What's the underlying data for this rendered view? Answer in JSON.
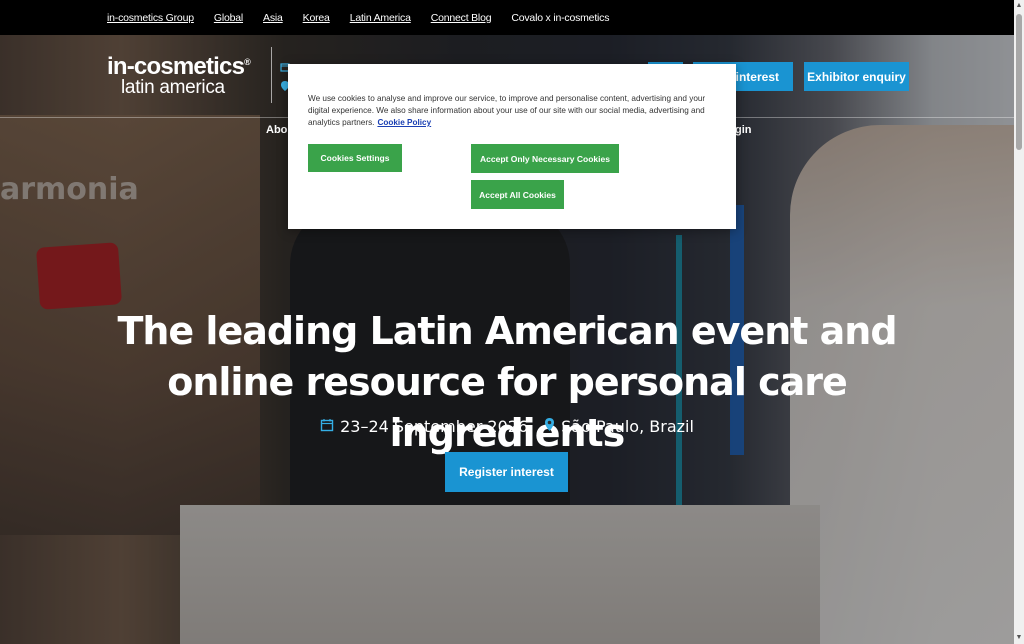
{
  "topbar": {
    "links": [
      {
        "label": "in-cosmetics Group"
      },
      {
        "label": "Global"
      },
      {
        "label": "Asia"
      },
      {
        "label": "Korea"
      },
      {
        "label": "Latin America"
      },
      {
        "label": "Connect Blog"
      },
      {
        "label": "Covalo x in-cosmetics"
      }
    ]
  },
  "header": {
    "logo_line1": "in-cosmetics",
    "logo_line2": "latin america",
    "logo_mark": "®",
    "buttons": {
      "register_partial": "er interest",
      "exhibitor": "Exhibitor enquiry"
    },
    "nav": {
      "about_partial": "Abou",
      "login_partial": "gin"
    }
  },
  "hero": {
    "background_sign": "armonia",
    "headline": "The leading Latin American event and online resource for personal care ingredients",
    "date": "23–24 September 2026",
    "location": "São Paulo, Brazil",
    "cta_label": "Register interest"
  },
  "cookie_banner": {
    "text": "We use cookies to analyse and improve our service, to improve and personalise content, advertising and your digital experience. We also share information about your use of our site with our social media, advertising and analytics partners.",
    "policy_link": "Cookie Policy",
    "settings_label": "Cookies Settings",
    "necessary_label": "Accept Only Necessary Cookies",
    "accept_all_label": "Accept All Cookies"
  },
  "colors": {
    "accent_blue": "#1a94d2",
    "cookie_green": "#3aa34a",
    "icon_blue": "#34aee4"
  },
  "icons": {
    "calendar": "calendar-icon",
    "location": "map-pin-icon"
  }
}
